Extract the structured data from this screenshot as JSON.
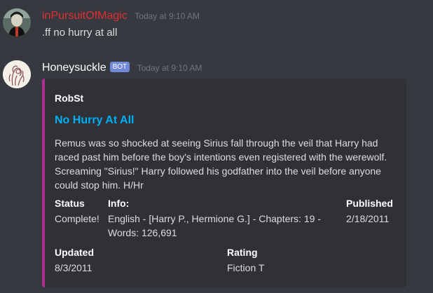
{
  "messages": [
    {
      "username": "inPursuitOfMagic",
      "username_color": "#e02f2f",
      "timestamp": "Today at 9:10 AM",
      "content": ".ff no hurry at all"
    },
    {
      "username": "Honeysuckle",
      "username_color": "#ffffff",
      "bot_tag": "BOT",
      "timestamp": "Today at 9:10 AM",
      "embed": {
        "accent_color": "#b0308f",
        "author": "RobSt",
        "title": "No Hurry At All",
        "description": "Remus was so shocked at seeing Sirius fall through the veil that Harry had raced past him before the boy's intentions even registered with the werewolf. Screaming \"Sirius!\" Harry followed his godfather into the veil before anyone could stop him. H/Hr",
        "fields": {
          "status": {
            "name": "Status",
            "value": "Complete!"
          },
          "info": {
            "name": "Info:",
            "value": "English - [Harry P., Hermione G.] - Chapters: 19 - Words: 126,691"
          },
          "published": {
            "name": "Published",
            "value": "2/18/2011"
          },
          "updated": {
            "name": "Updated",
            "value": "8/3/2011"
          },
          "rating": {
            "name": "Rating",
            "value": "Fiction T"
          }
        }
      }
    }
  ]
}
